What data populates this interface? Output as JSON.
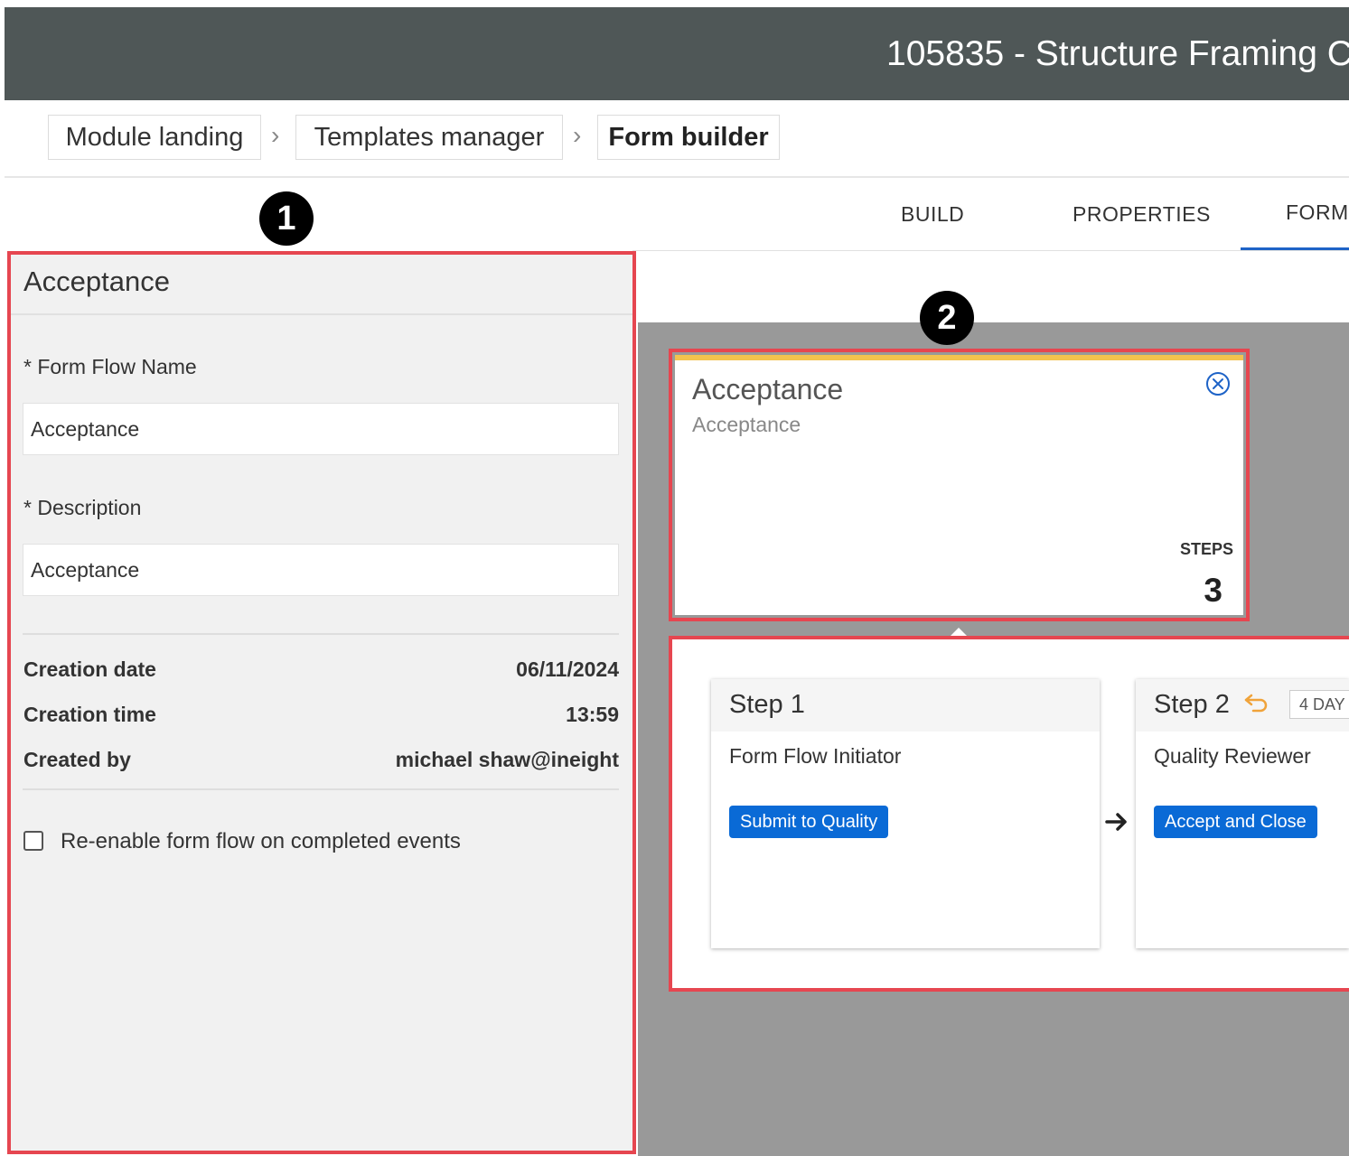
{
  "header": {
    "title": "105835 - Structure Framing C"
  },
  "breadcrumb": [
    {
      "label": "Module landing"
    },
    {
      "label": "Templates manager"
    },
    {
      "label": "Form builder"
    }
  ],
  "tabs": [
    {
      "label": "BUILD"
    },
    {
      "label": "PROPERTIES"
    },
    {
      "label": "FORM"
    }
  ],
  "markers": {
    "one": "1",
    "two": "2"
  },
  "left_panel": {
    "title": "Acceptance",
    "name_label": "* Form Flow Name",
    "name_value": "Acceptance",
    "description_label": "* Description",
    "description_value": "Acceptance",
    "creation_date_label": "Creation date",
    "creation_date_value": "06/11/2024",
    "creation_time_label": "Creation time",
    "creation_time_value": "13:59",
    "created_by_label": "Created by",
    "created_by_value": "michael shaw@ineight",
    "reenable_label": "Re-enable form flow on completed events",
    "reenable_checked": false
  },
  "flow_card": {
    "title": "Acceptance",
    "subtitle": "Acceptance",
    "steps_label": "STEPS",
    "steps_count": "3",
    "accent_color": "#f4c24e",
    "icon": "close-circle-icon"
  },
  "steps": [
    {
      "title": "Step 1",
      "role": "Form Flow Initiator",
      "action": "Submit to Quality"
    },
    {
      "title": "Step 2",
      "role": "Quality Reviewer",
      "action": "Accept and Close",
      "duration": "4 DAY",
      "icon": "return-arrow-icon"
    }
  ],
  "colors": {
    "header_bg": "#4f5757",
    "highlight": "#e64650",
    "action_blue": "#0a6ad6",
    "tab_active": "#1e63c7"
  }
}
